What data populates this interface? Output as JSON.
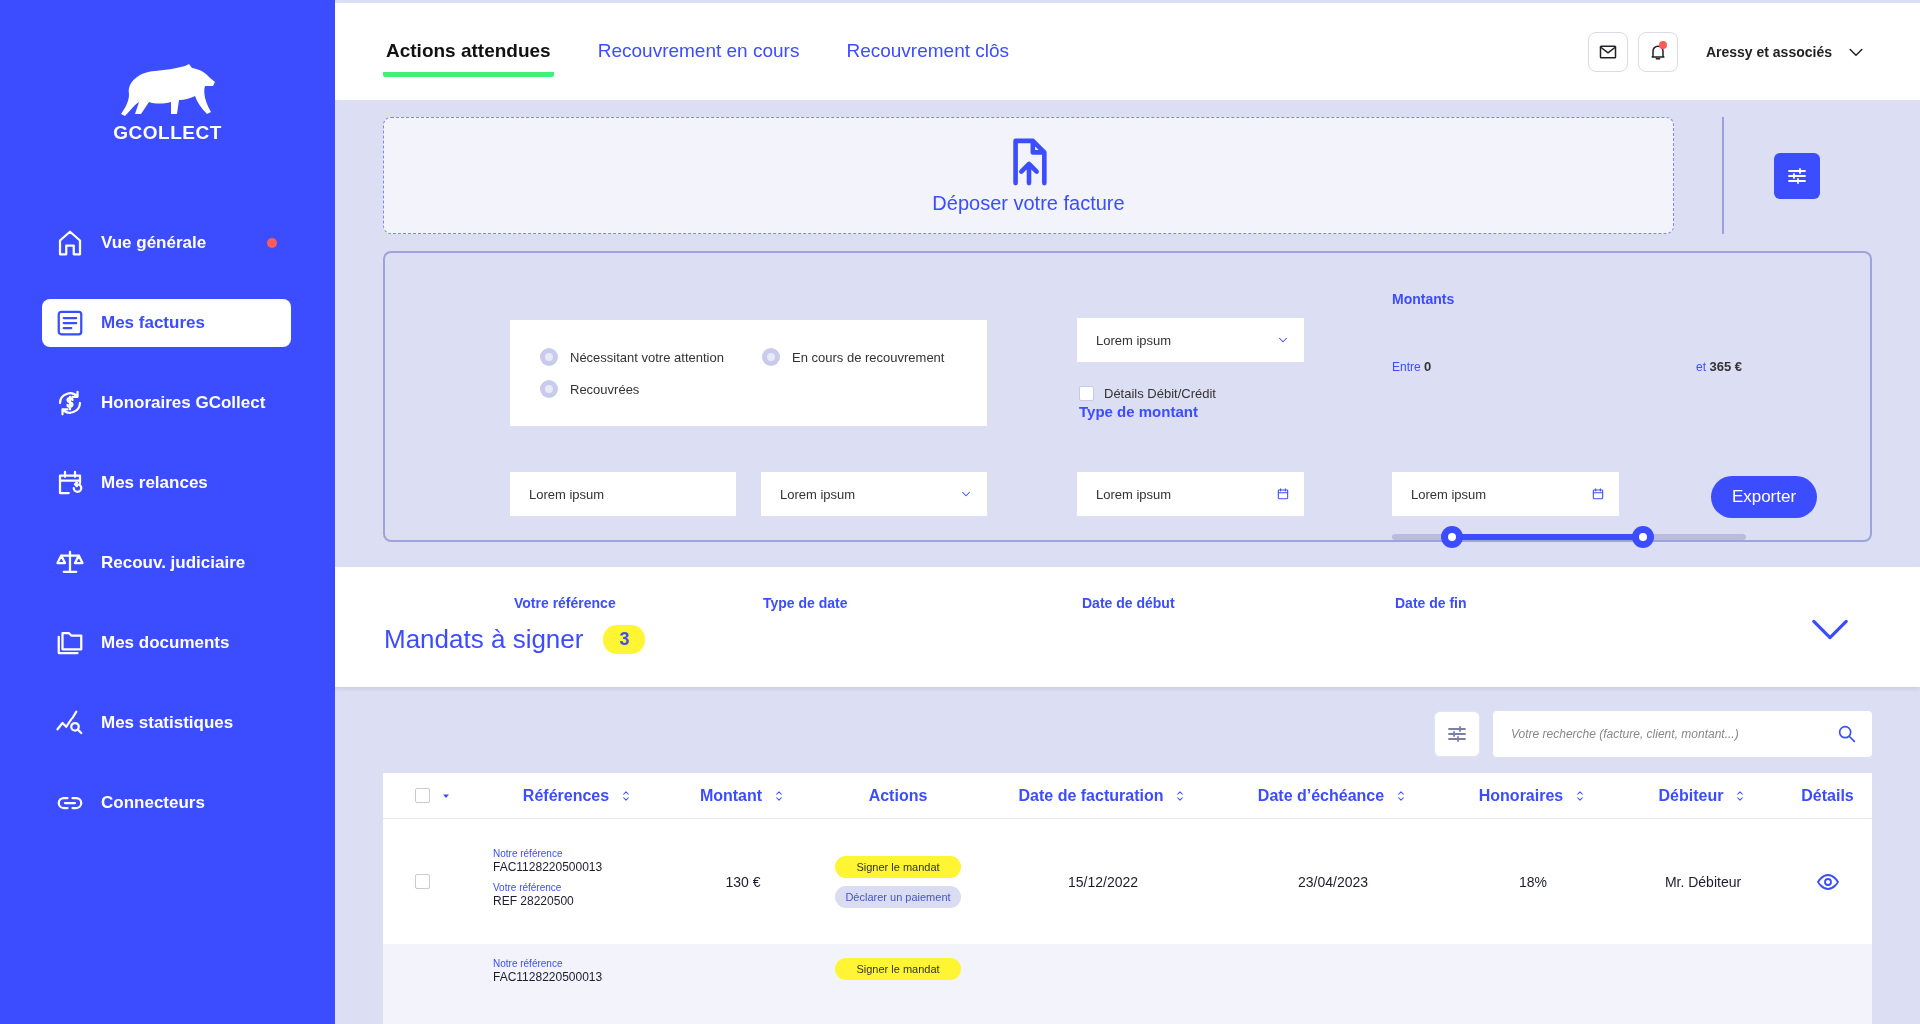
{
  "logo": {
    "text": "GCOLLECT"
  },
  "sidebar": {
    "items": [
      {
        "label": "Vue générale",
        "selected": false,
        "notification": true
      },
      {
        "label": "Mes factures",
        "selected": true,
        "notification": false
      },
      {
        "label": "Honoraires GCollect",
        "selected": false,
        "notification": false
      },
      {
        "label": "Mes relances",
        "selected": false,
        "notification": false
      },
      {
        "label": "Recouv. judiciaire",
        "selected": false,
        "notification": false
      },
      {
        "label": "Mes documents",
        "selected": false,
        "notification": false
      },
      {
        "label": "Mes statistiques",
        "selected": false,
        "notification": false
      },
      {
        "label": "Connecteurs",
        "selected": false,
        "notification": false
      }
    ]
  },
  "tabs": [
    {
      "label": "Actions attendues",
      "selected": true
    },
    {
      "label": "Recouvrement en cours",
      "selected": false
    },
    {
      "label": "Recouvrement clôs",
      "selected": false
    }
  ],
  "header": {
    "bell_unread": true,
    "account": "Aressy et associés"
  },
  "upload": {
    "label": "Déposer votre facture"
  },
  "filters": {
    "radios": [
      {
        "label": "Nécessitant votre attention",
        "selected": false
      },
      {
        "label": "En cours de recouvrement",
        "selected": false
      },
      {
        "label": "Recouvrées",
        "selected": false
      }
    ],
    "amount_type": {
      "value": "Lorem ipsum",
      "checkbox": {
        "label": "Détails Débit/Crédit",
        "checked": false
      },
      "caption": "Type de montant"
    },
    "amounts": {
      "title": "Montants",
      "min_label": "Entre",
      "min": "0",
      "max_label": "et",
      "max": "365 €",
      "thumbs": [
        {
          "level": 0.17
        },
        {
          "level": 0.71
        }
      ]
    },
    "fields": [
      {
        "kind": "text",
        "value": "Lorem ipsum"
      },
      {
        "kind": "select",
        "value": "Lorem ipsum"
      },
      {
        "kind": "date",
        "value": "Lorem ipsum"
      },
      {
        "kind": "date",
        "value": "Lorem ipsum"
      }
    ],
    "export": "Exporter"
  },
  "mandates": {
    "title": "Mandats à signer",
    "count": "3",
    "columns": [
      "Votre référence",
      "Type de date",
      "Date de début",
      "Date de fin"
    ]
  },
  "search": {
    "placeholder": "Votre recherche (facture, client, montant...)"
  },
  "table": {
    "select_all": {
      "checked": false
    },
    "columns": [
      {
        "label": "Références",
        "sortable": true
      },
      {
        "label": "Montant",
        "sortable": true
      },
      {
        "label": "Actions",
        "sortable": false
      },
      {
        "label": "Date de facturation",
        "sortable": true
      },
      {
        "label": "Date d’échéance",
        "sortable": true
      },
      {
        "label": "Honoraires",
        "sortable": true
      },
      {
        "label": "Débiteur",
        "sortable": true
      },
      {
        "label": "Détails",
        "sortable": false
      }
    ],
    "rows": [
      {
        "checked": false,
        "our_ref_label": "Notre référence",
        "our_ref": "FAC1128220500013",
        "your_ref_label": "Votre référence",
        "your_ref": "REF 28220500",
        "amount": "130 €",
        "actions": [
          {
            "label": "Signer le mandat",
            "kind": "primary"
          },
          {
            "label": "Déclarer un paiement",
            "kind": "secondary"
          }
        ],
        "invoice_date": "15/12/2022",
        "due_date": "23/04/2023",
        "fees": "18%",
        "debtor": "Mr. Débiteur",
        "details": true
      },
      {
        "our_ref_label": "Notre référence",
        "our_ref": "FAC1128220500013",
        "actions": [
          {
            "label": "Signer le mandat",
            "kind": "primary"
          }
        ]
      }
    ]
  }
}
